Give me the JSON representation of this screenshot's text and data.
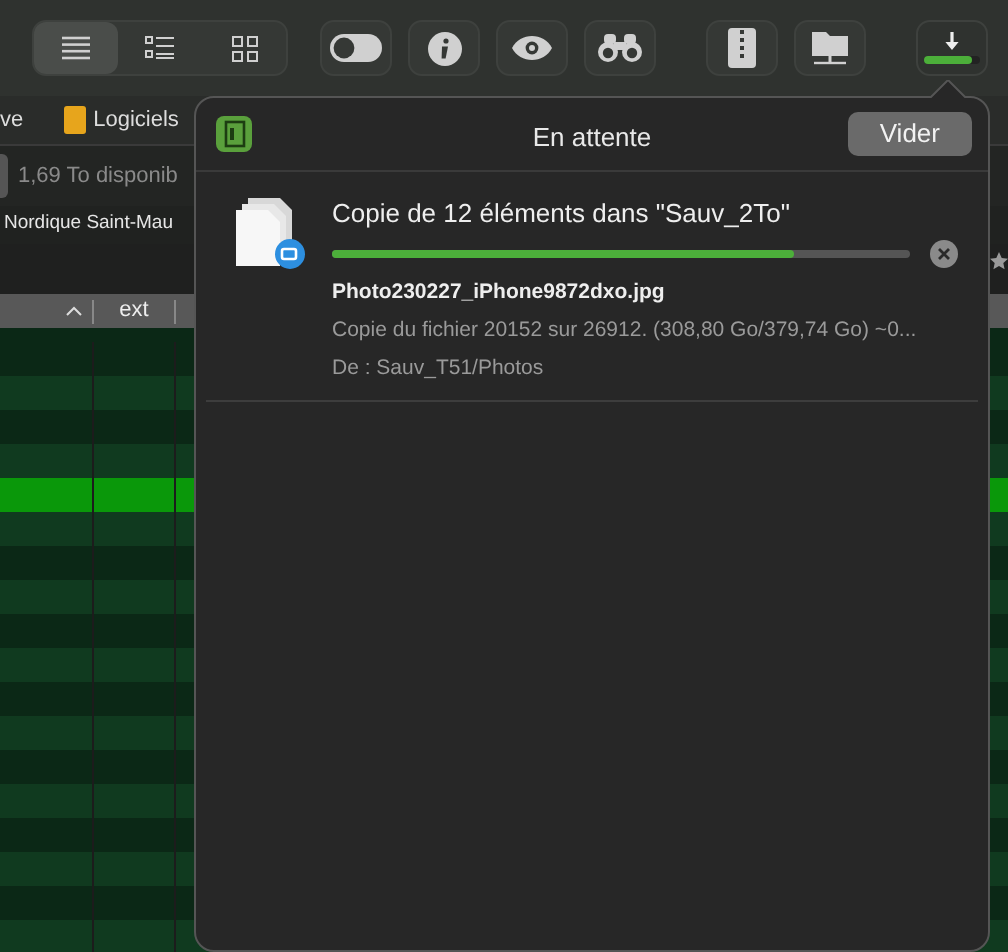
{
  "toolbar": {
    "view_modes": [
      {
        "kind": "list",
        "selected": true
      },
      {
        "kind": "columns",
        "selected": false
      },
      {
        "kind": "grid",
        "selected": false
      }
    ],
    "buttons": [
      {
        "kind": "toggle"
      },
      {
        "kind": "info"
      },
      {
        "kind": "eye"
      },
      {
        "kind": "binoculars"
      },
      {
        "kind": "archive"
      },
      {
        "kind": "network"
      },
      {
        "kind": "download",
        "level": 0.85
      }
    ]
  },
  "window": {
    "path_fragment": "ve",
    "location": "Logiciels",
    "free_space": "1,69 To disponib",
    "folder_name": "Nordique Saint-Mau",
    "columns": [
      {
        "label": "ext"
      }
    ],
    "rows": [
      {
        "selected": false
      },
      {
        "selected": false
      },
      {
        "selected": false
      },
      {
        "selected": false
      },
      {
        "selected": true
      },
      {
        "selected": false
      },
      {
        "selected": false
      },
      {
        "selected": false
      },
      {
        "selected": false
      },
      {
        "selected": false
      },
      {
        "selected": false
      },
      {
        "selected": false
      },
      {
        "selected": false
      },
      {
        "selected": false
      },
      {
        "selected": false
      },
      {
        "selected": false
      },
      {
        "selected": false
      },
      {
        "selected": false
      }
    ]
  },
  "popover": {
    "title": "En attente",
    "clear_button": "Vider",
    "tasks": [
      {
        "title": "Copie de 12 éléments dans \"Sauv_2To\"",
        "level": 0.8,
        "file": "Photo230227_iPhone9872dxo.jpg",
        "detail": "Copie du fichier 20152 sur 26912. (308,80 Go/379,74 Go) ~0...",
        "source": "De : Sauv_T51/Photos"
      }
    ]
  }
}
